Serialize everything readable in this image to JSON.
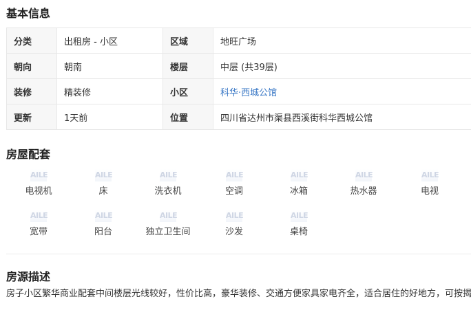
{
  "basic": {
    "title": "基本信息",
    "rows": [
      {
        "k1": "分类",
        "v1": "出租房 - 小区",
        "k2": "区域",
        "v2": "地旺广场"
      },
      {
        "k1": "朝向",
        "v1": "朝南",
        "k2": "楼层",
        "v2": "中层 (共39层)"
      },
      {
        "k1": "装修",
        "v1": "精装修",
        "k2": "小区",
        "v2": "科华·西城公馆"
      },
      {
        "k1": "更新",
        "v1": "1天前",
        "k2": "位置",
        "v2": "四川省达州市渠县西溪街科华西城公馆"
      }
    ]
  },
  "facilities": {
    "title": "房屋配套",
    "icon_text": "AILE",
    "items": [
      {
        "label": "电视机",
        "icon": "tv-icon"
      },
      {
        "label": "床",
        "icon": "bed-icon"
      },
      {
        "label": "洗衣机",
        "icon": "washing-machine-icon"
      },
      {
        "label": "空调",
        "icon": "air-conditioner-icon"
      },
      {
        "label": "冰箱",
        "icon": "fridge-icon"
      },
      {
        "label": "热水器",
        "icon": "water-heater-icon"
      },
      {
        "label": "电视",
        "icon": "television-icon"
      },
      {
        "label": "宽带",
        "icon": "broadband-icon"
      },
      {
        "label": "阳台",
        "icon": "balcony-icon"
      },
      {
        "label": "独立卫生间",
        "icon": "bathroom-icon"
      },
      {
        "label": "沙发",
        "icon": "sofa-icon"
      },
      {
        "label": "桌椅",
        "icon": "table-chair-icon"
      }
    ]
  },
  "description": {
    "title": "房源描述",
    "text": "房子小区繁华商业配套中间楼层光线较好，性价比高，豪华装修、交通方便家具家电齐全，适合居住的好地方，可按揭"
  },
  "colors": {
    "link": "#3a78c6",
    "label_bg": "#f7f7f7",
    "border": "#e8e8e8"
  }
}
